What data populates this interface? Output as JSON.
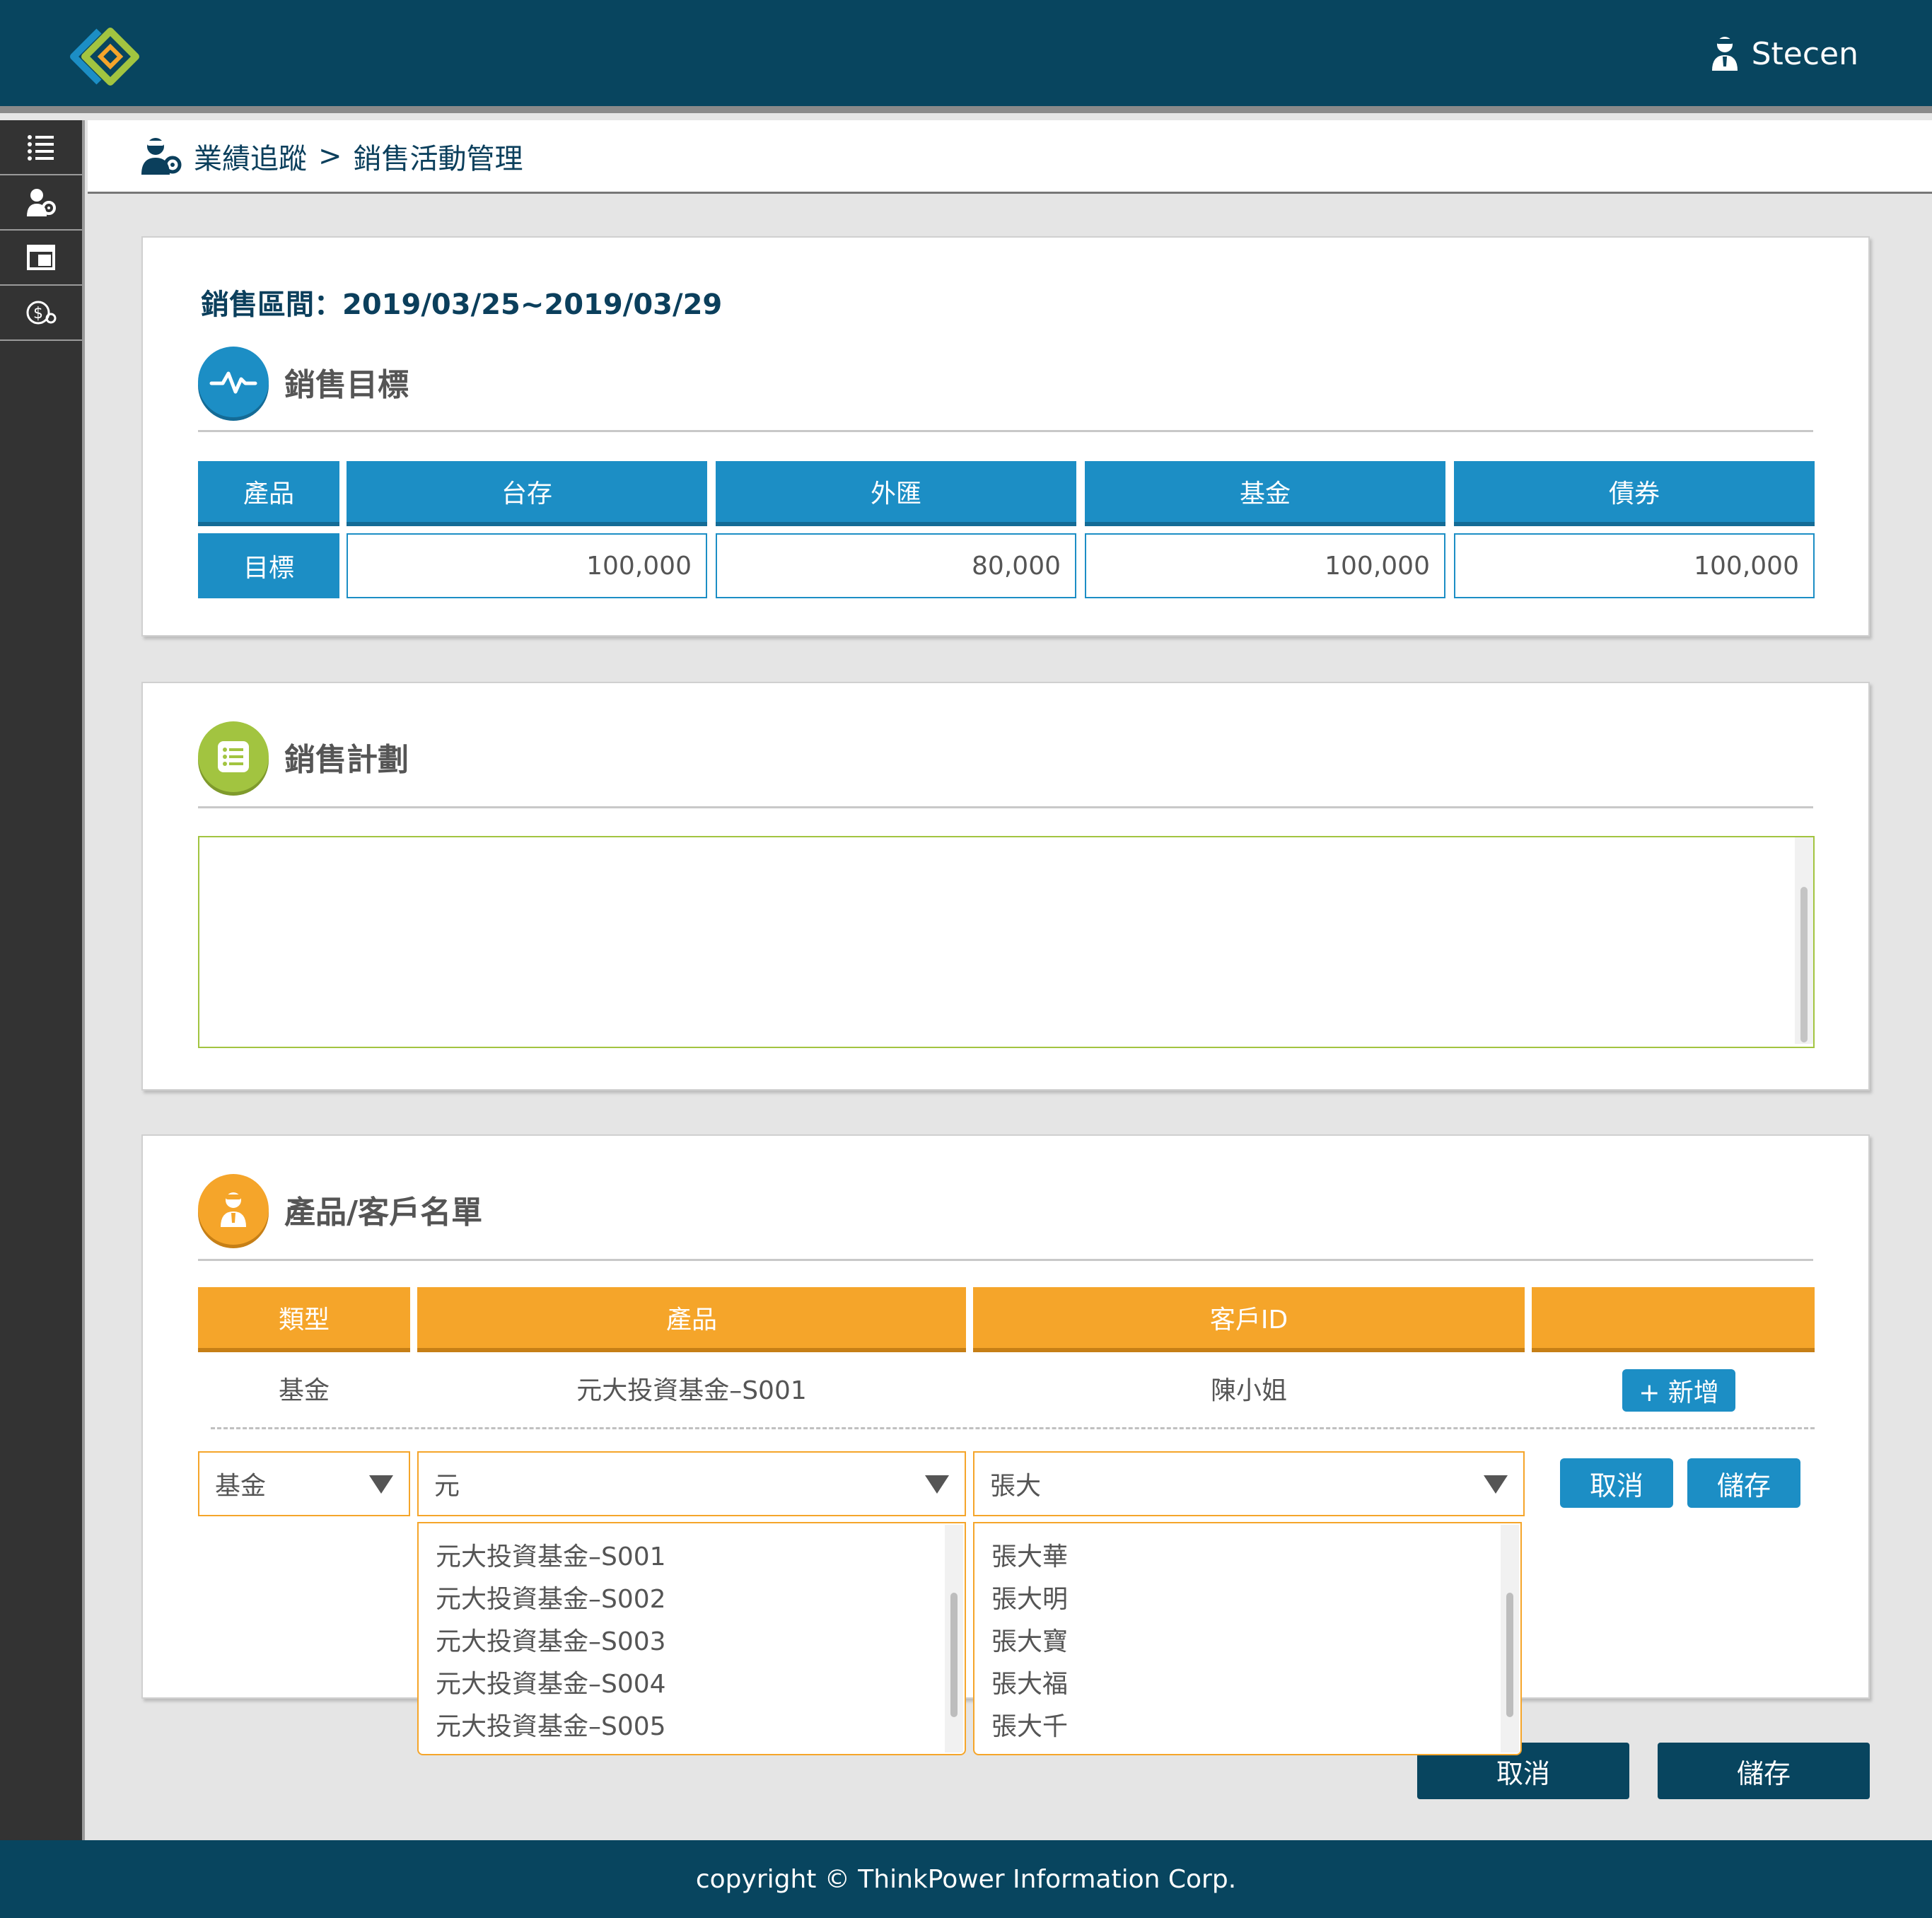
{
  "header": {
    "user_name": "Stecen"
  },
  "sidebar": {
    "items": [
      {
        "icon": "list-icon"
      },
      {
        "icon": "user-gear-icon"
      },
      {
        "icon": "layout-icon"
      },
      {
        "icon": "dollar-gear-icon"
      }
    ]
  },
  "breadcrumb": {
    "level1": "業績追蹤",
    "separator": ">",
    "level2": "銷售活動管理"
  },
  "sales_target": {
    "period_label": "銷售區間：2019/03/25~2019/03/29",
    "title": "銷售目標",
    "row_header": "產品",
    "row_label": "目標",
    "columns": [
      "台存",
      "外匯",
      "基金",
      "債券"
    ],
    "values": [
      "100,000",
      "80,000",
      "100,000",
      "100,000"
    ]
  },
  "sales_plan": {
    "title": "銷售計劃",
    "content": ""
  },
  "product_list": {
    "title": "產品/客戶名單",
    "columns": [
      "類型",
      "產品",
      "客戶ID",
      ""
    ],
    "row": {
      "type": "基金",
      "product": "元大投資基金–S001",
      "customer": "陳小姐"
    },
    "add_label": "+ 新增",
    "edit": {
      "type_value": "基金",
      "product_value": "元",
      "customer_value": "張大",
      "cancel_label": "取消",
      "save_label": "儲存"
    },
    "product_options": [
      "元大投資基金–S001",
      "元大投資基金–S002",
      "元大投資基金–S003",
      "元大投資基金–S004",
      "元大投資基金–S005"
    ],
    "customer_options": [
      "張大華",
      "張大明",
      "張大寶",
      "張大福",
      "張大千"
    ]
  },
  "actions": {
    "cancel_label": "取消",
    "save_label": "儲存"
  },
  "footer": {
    "copyright": "copyright © ThinkPower Information Corp."
  },
  "colors": {
    "header_bg": "#08455f",
    "blue": "#1c8ec5",
    "orange": "#f5a52a",
    "green": "#a2c440"
  }
}
